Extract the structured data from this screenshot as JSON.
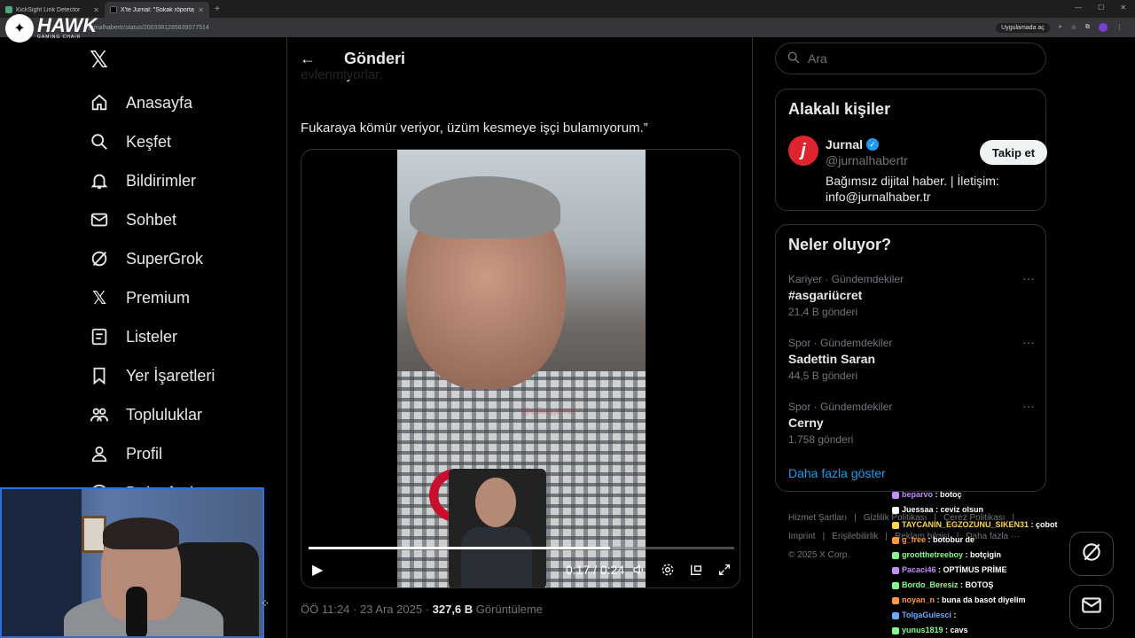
{
  "browser": {
    "tabs": [
      {
        "title": "KickSight Link Detector",
        "active": false
      },
      {
        "title": "X'te Jurnal: \"Sokak röportajında...",
        "active": true
      }
    ],
    "url": "jurnalhabertr/status/2003381285839077514",
    "open_app_label": "Uygulamada aç"
  },
  "overlay_logo": {
    "word": "HAWK",
    "sub": "GAMING CHAIR"
  },
  "nav": {
    "items": [
      {
        "label": "Anasayfa",
        "icon": "home-icon"
      },
      {
        "label": "Keşfet",
        "icon": "search-icon"
      },
      {
        "label": "Bildirimler",
        "icon": "bell-icon"
      },
      {
        "label": "Sohbet",
        "icon": "mail-icon"
      },
      {
        "label": "SuperGrok",
        "icon": "grok-icon"
      },
      {
        "label": "Premium",
        "icon": "x-icon"
      },
      {
        "label": "Listeler",
        "icon": "list-icon"
      },
      {
        "label": "Yer İşaretleri",
        "icon": "bookmark-icon"
      },
      {
        "label": "Topluluklar",
        "icon": "communities-icon"
      },
      {
        "label": "Profil",
        "icon": "profile-icon"
      }
    ],
    "more_partial": "Daha fazla"
  },
  "post": {
    "header_title": "Gönderi",
    "text_partial": "evlenmiyorlar.",
    "text": "Fukaraya kömür veriyor, üzüm kesmeye işçi bulamıyorum.”",
    "watermark": "@odkeyjurnal",
    "video": {
      "current": "0:17",
      "separator": "/",
      "duration": "0:24",
      "progress": 0.708
    },
    "meta_time": "ÖÖ 11:24 · 23 Ara 2025 · ",
    "views": "327,6 B",
    "views_label": "Görüntüleme"
  },
  "search": {
    "placeholder": "Ara"
  },
  "related": {
    "title": "Alakalı kişiler",
    "name": "Jurnal",
    "handle": "@jurnalhabertr",
    "bio": "Bağımsız dijital haber. | İletişim: info@jurnalhaber.tr",
    "follow_label": "Takip et"
  },
  "trends": {
    "title": "Neler oluyor?",
    "items": [
      {
        "category": "Kariyer · Gündemdekiler",
        "topic": "#asgariücret",
        "count": "21,4 B gönderi"
      },
      {
        "category": "Spor · Gündemdekiler",
        "topic": "Sadettin Saran",
        "count": "44,5 B gönderi"
      },
      {
        "category": "Spor · Gündemdekiler",
        "topic": "Cerny",
        "count": "1.758 gönderi"
      }
    ],
    "show_more": "Daha fazla göster"
  },
  "footer": {
    "links": [
      "Hizmet Şartları",
      "|",
      "Gizlilik Politikası",
      "|",
      "Çerez Politikası",
      "|",
      "Imprint",
      "|",
      "Erişilebilirlik",
      "|",
      "Reklam bilgisi",
      "|",
      "Daha fazla ···"
    ],
    "copyright": "© 2025 X Corp."
  },
  "chat": [
    {
      "user": "beparvo",
      "color": "#c58cff",
      "text": "botoç"
    },
    {
      "user": "Juessaa",
      "color": "#ffffff",
      "text": "ceviz olsun"
    },
    {
      "user": "TAYCANIN_EGZOZUNU_SIKEN31",
      "color": "#ffd54a",
      "text": "çobot"
    },
    {
      "user": "g_free",
      "color": "#ff9a3c",
      "text": "botobur de"
    },
    {
      "user": "grootthetreeboy",
      "color": "#7dff8a",
      "text": "botçigin"
    },
    {
      "user": "Pacaci46",
      "color": "#c58cff",
      "text": "OPTİMUS PRİME"
    },
    {
      "user": "Bordo_Beresiz",
      "color": "#7dff8a",
      "text": "BOTOŞ"
    },
    {
      "user": "noyan_n",
      "color": "#ff9a3c",
      "text": "buna da basot diyelim"
    },
    {
      "user": "TolgaGulesci",
      "color": "#6fa8ff",
      "text": ""
    },
    {
      "user": "yunus1819",
      "color": "#7dff8a",
      "text": "cavs"
    }
  ]
}
